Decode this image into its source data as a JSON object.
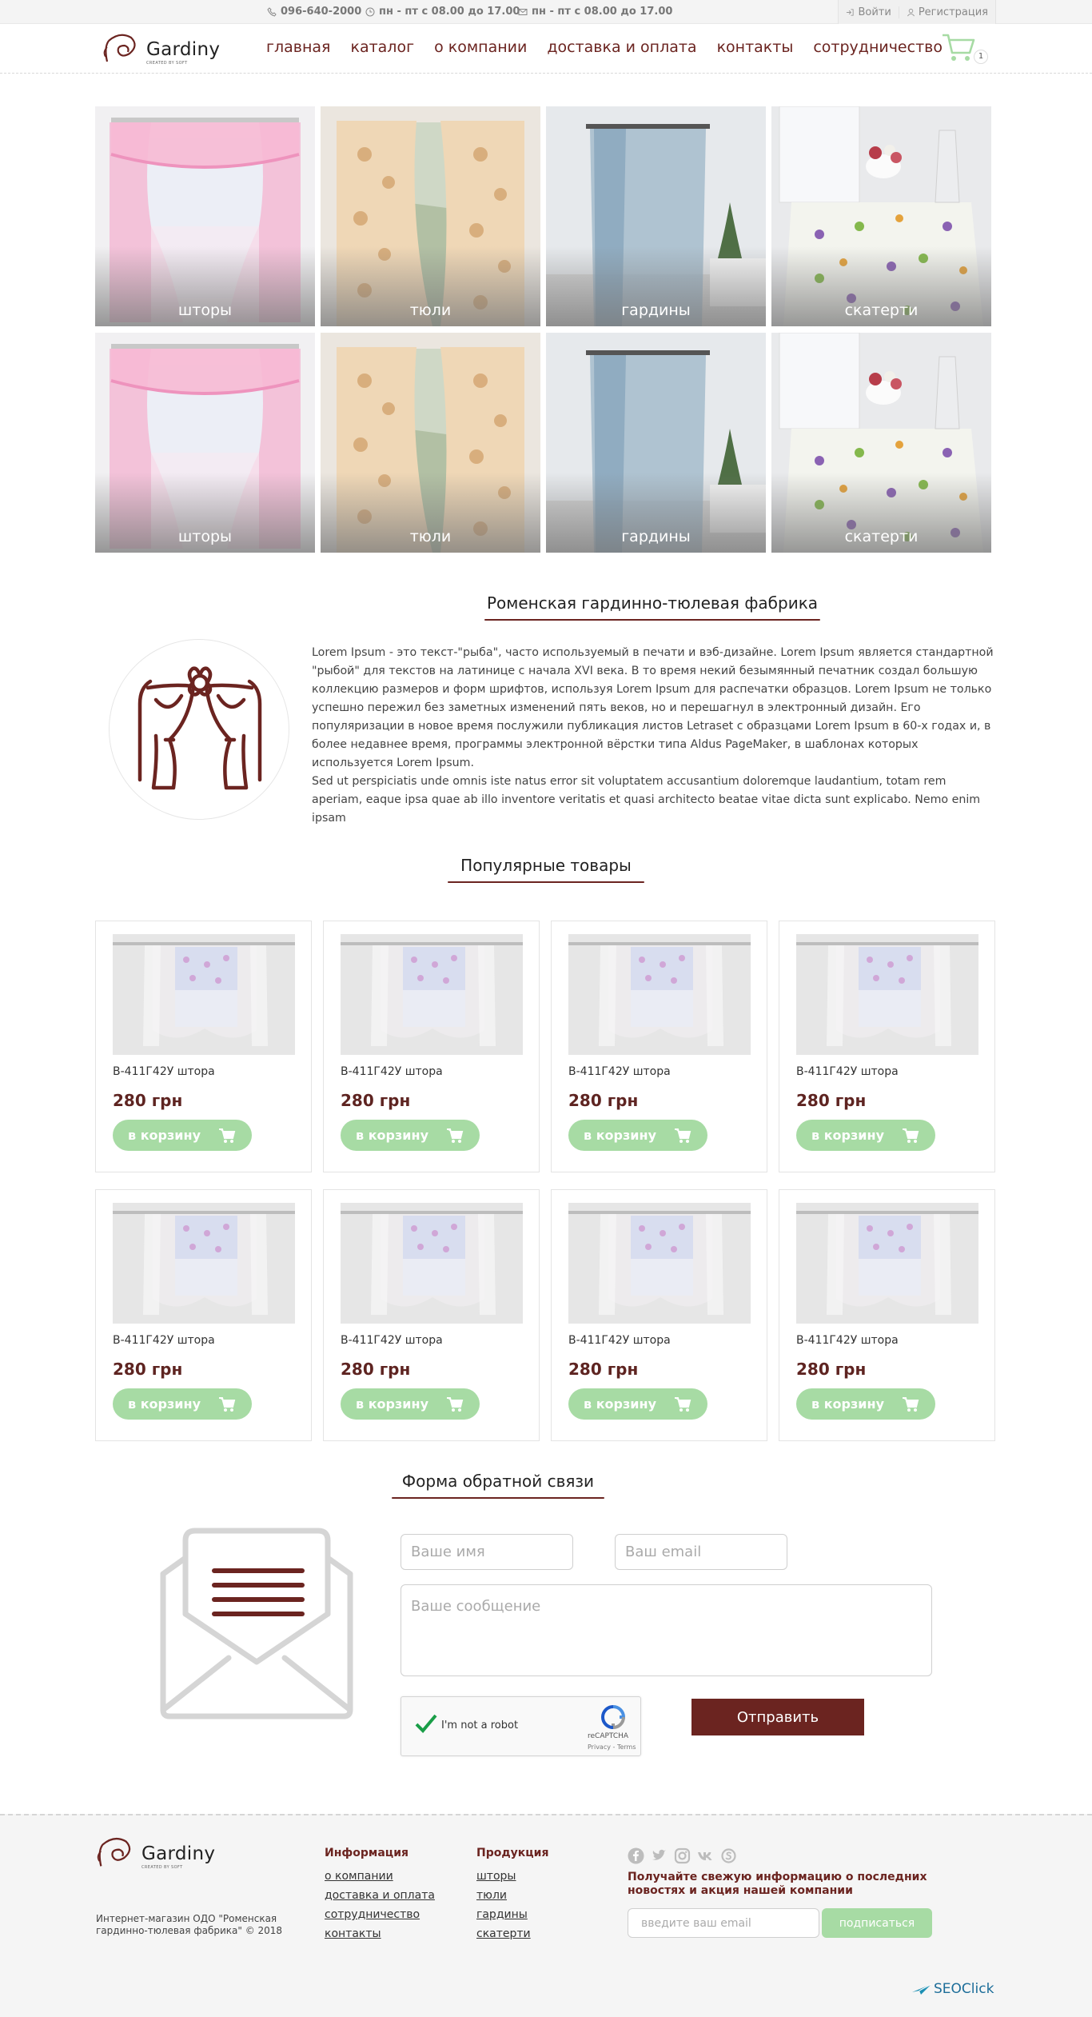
{
  "topbar": {
    "phone": "096-640-2000",
    "hours1": "пн - пт с 08.00 до 17.00",
    "hours2": "пн - пт с 08.00 до 17.00",
    "login": "Войти",
    "register": "Регистрация"
  },
  "logo": {
    "word": "Gardiny",
    "sub": "CREATED BY SOFT"
  },
  "nav": [
    "главная",
    "каталог",
    "о компании",
    "доставка и оплата",
    "контакты",
    "сотрудничество"
  ],
  "cart": {
    "count": "1"
  },
  "categories": [
    "шторы",
    "тюли",
    "гардины",
    "скатерти",
    "шторы",
    "тюли",
    "гардины",
    "скатерти"
  ],
  "about": {
    "title": "Роменская гардинно-тюлевая фабрика",
    "text1": "Lorem Ipsum - это текст-\"рыба\", часто используемый в печати и вэб-дизайне. Lorem Ipsum является стандартной \"рыбой\" для текстов на латинице с начала XVI века. В то время некий безымянный печатник создал большую коллекцию размеров и форм шрифтов, используя Lorem Ipsum для распечатки образцов. Lorem Ipsum не только успешно пережил без заметных изменений пять веков, но и перешагнул в электронный дизайн. Его популяризации в новое время послужили публикация листов Letraset с образцами Lorem Ipsum в 60-х годах и, в более недавнее время, программы электронной вёрстки типа Aldus PageMaker, в шаблонах которых используется Lorem Ipsum.",
    "text2": "Sed ut perspiciatis unde omnis iste natus error sit voluptatem accusantium doloremque laudantium, totam rem aperiam, eaque ipsa quae ab illo inventore veritatis et quasi architecto beatae vitae dicta sunt explicabo. Nemo enim ipsam"
  },
  "popular": {
    "title": "Популярные товары",
    "products": [
      {
        "name": "B-411Г42У штора",
        "price": "280 грн",
        "button": "в корзину"
      },
      {
        "name": "B-411Г42У штора",
        "price": "280 грн",
        "button": "в корзину"
      },
      {
        "name": "B-411Г42У штора",
        "price": "280 грн",
        "button": "в корзину"
      },
      {
        "name": "B-411Г42У штора",
        "price": "280 грн",
        "button": "в корзину"
      },
      {
        "name": "B-411Г42У штора",
        "price": "280 грн",
        "button": "в корзину"
      },
      {
        "name": "B-411Г42У штора",
        "price": "280 грн",
        "button": "в корзину"
      },
      {
        "name": "B-411Г42У штора",
        "price": "280 грн",
        "button": "в корзину"
      },
      {
        "name": "B-411Г42У штора",
        "price": "280 грн",
        "button": "в корзину"
      }
    ]
  },
  "feedback": {
    "title": "Форма обратной связи",
    "name_placeholder": "Ваше имя",
    "email_placeholder": "Ваш email",
    "message_placeholder": "Ваше сообщение",
    "captcha_label": "I'm not a robot",
    "captcha_brand": "reCAPTCHA",
    "captcha_links": "Privacy - Terms",
    "submit": "Отправить"
  },
  "footer": {
    "copyright": "Интернет-магазин ОДО \"Роменская гардинно-тюлевая фабрика\" © 2018",
    "info_title": "Информация",
    "info_links": [
      "о компании",
      "доставка и оплата",
      "сотрудничество",
      "контакты"
    ],
    "products_title": "Продукция",
    "products_links": [
      "шторы",
      "тюли",
      "гардины",
      "скатерти"
    ],
    "social_icons": [
      "facebook-icon",
      "twitter-icon",
      "instagram-icon",
      "vk-icon",
      "skype-icon"
    ],
    "newsletter_text": "Получайте свежую информацию о последних новостях и акция нашей компании",
    "email_placeholder": "введите ваш email",
    "subscribe": "подписаться",
    "seo": "SEOClick"
  },
  "colors": {
    "brand": "#6b2420",
    "accent_green": "#a7dba4",
    "topbar_bg": "#f4f4f4",
    "footer_bg": "#f5f5f5"
  }
}
